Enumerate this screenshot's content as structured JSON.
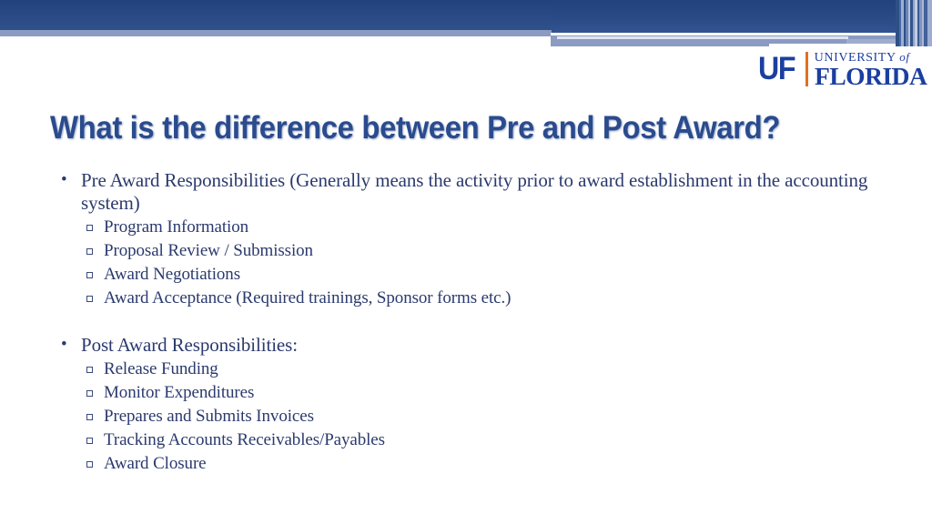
{
  "slide": {
    "title": "What is the difference between Pre and Post Award?",
    "logo": {
      "mark": "UF",
      "line1": "UNIVERSITY",
      "line1_suffix": "of",
      "line2": "FLORIDA"
    },
    "colors": {
      "banner_dark": "#2a4b86",
      "banner_light": "#8b9bc2",
      "title_text": "#2a4b8d",
      "body_text": "#2b3a6e",
      "logo_blue": "#1b3fa0",
      "logo_orange": "#e07020"
    },
    "groups": [
      {
        "heading": "Pre Award Responsibilities (Generally means the activity prior to award establishment in the accounting system)",
        "items": [
          "Program Information",
          "Proposal Review / Submission",
          "Award Negotiations",
          "Award Acceptance (Required trainings, Sponsor forms etc.)"
        ]
      },
      {
        "heading": "Post Award Responsibilities:",
        "items": [
          "Release Funding",
          "Monitor Expenditures",
          "Prepares and Submits Invoices",
          "Tracking Accounts Receivables/Payables",
          "Award Closure"
        ]
      }
    ]
  }
}
